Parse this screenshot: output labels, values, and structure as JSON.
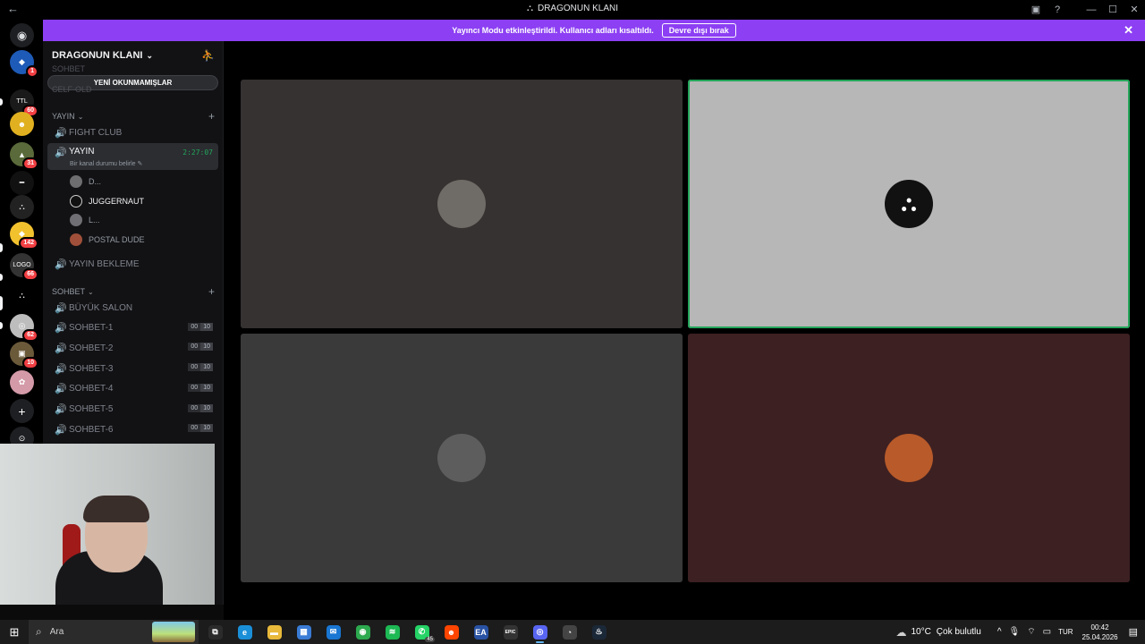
{
  "window": {
    "back_icon": "←",
    "server_logo": "⛬",
    "title": "DRAGONUN KLANI",
    "inbox_icon": "▣",
    "help_icon": "?",
    "minimize_icon": "—",
    "maximize_icon": "☐",
    "close_icon": "✕"
  },
  "banner": {
    "message": "Yayıncı Modu etkinleştirildi. Kullanıcı adları kısaltıldı.",
    "button_label": "Devre dışı bırak",
    "close_icon": "✕"
  },
  "rail": {
    "home_icon": "◉",
    "servers": [
      {
        "label": "◆",
        "badge": "1",
        "color": "#1e5bb8"
      },
      {
        "label": "TTL",
        "badge": "60",
        "color": "#1a1a1a"
      },
      {
        "label": "☻",
        "badge": "",
        "color": "#e0b020"
      },
      {
        "label": "▲",
        "badge": "31",
        "color": "#5a6a3a"
      },
      {
        "label": "━",
        "badge": "",
        "color": "#111"
      },
      {
        "label": "⛬",
        "badge": "",
        "color": "#222"
      },
      {
        "label": "◆",
        "badge": "142",
        "color": "#f2c12e"
      },
      {
        "label": "LOGO",
        "badge": "66",
        "color": "#333"
      },
      {
        "label": "⛬",
        "badge": "",
        "color": "#000"
      },
      {
        "label": "◎",
        "badge": "62",
        "color": "#bdbdbd"
      },
      {
        "label": "▣",
        "badge": "10",
        "color": "#6b5a3a"
      },
      {
        "label": "✿",
        "badge": "",
        "color": "#d49aa8"
      }
    ],
    "add_icon": "+",
    "discover_icon": "⊙"
  },
  "sidebar": {
    "server_name": "DRAGONUN KLANI",
    "chevron": "⌄",
    "invite_icon": "⛹",
    "unread_label": "YENİ OKUNMAMIŞLAR",
    "faded_above": "SOHBET",
    "faded_above_2": "CELF-OLD",
    "categories": {
      "yayin": "YAYIN",
      "sohbet": "SOHBET"
    },
    "cat_chevron": "⌄",
    "plus": "+",
    "channels_yayin": [
      {
        "name": "FIGHT CLUB"
      }
    ],
    "active_channel": {
      "name": "YAYIN",
      "timer": "2:27:07",
      "status": "Bir kanal durumu belirle ✎"
    },
    "members": [
      {
        "name": "D...",
        "bright": false,
        "color": "#6e6e70"
      },
      {
        "name": "JUGGERNAUT",
        "bright": true,
        "color": "#111"
      },
      {
        "name": "L...",
        "bright": false,
        "color": "#707074"
      },
      {
        "name": "POSTAL DUDE",
        "bright": false,
        "color": "#a0503a"
      }
    ],
    "channel_bekleme": "YAYIN BEKLEME",
    "channels_sohbet": [
      {
        "name": "BÜYÜK SALON",
        "limit": false
      },
      {
        "name": "SOHBET-1",
        "limit": true
      },
      {
        "name": "SOHBET-2",
        "limit": true
      },
      {
        "name": "SOHBET-3",
        "limit": true
      },
      {
        "name": "SOHBET-4",
        "limit": true
      },
      {
        "name": "SOHBET-5",
        "limit": true
      },
      {
        "name": "SOHBET-6",
        "limit": true
      }
    ],
    "limit_current": "00",
    "limit_max": "10",
    "speaker_icon": "🔊"
  },
  "main": {
    "tiles": [
      {
        "bg": "#353231",
        "avatar_color": "#6f6b66",
        "speaking": false,
        "label": ""
      },
      {
        "bg": "#b7b7b7",
        "avatar_color": "#111111",
        "speaking": true,
        "label": "⛬"
      },
      {
        "bg": "#3a3a3a",
        "avatar_color": "#5d5d5d",
        "speaking": false,
        "label": ""
      },
      {
        "bg": "#3d2022",
        "avatar_color": "#b85a2a",
        "speaking": false,
        "label": ""
      }
    ]
  },
  "taskbar": {
    "start_icon": "⊞",
    "search_icon": "⌕",
    "search_placeholder": "Ara",
    "apps": [
      {
        "icon": "⧉",
        "color": "#2b2b2b",
        "active": false,
        "badge": ""
      },
      {
        "icon": "e",
        "color": "#1a8fd8",
        "active": false,
        "badge": ""
      },
      {
        "icon": "▬",
        "color": "#e8b93a",
        "active": false,
        "badge": ""
      },
      {
        "icon": "▦",
        "color": "#3a7bd5",
        "active": false,
        "badge": ""
      },
      {
        "icon": "✉",
        "color": "#1976d2",
        "active": false,
        "badge": ""
      },
      {
        "icon": "◉",
        "color": "#2da94f",
        "active": false,
        "badge": ""
      },
      {
        "icon": "≋",
        "color": "#1db954",
        "active": false,
        "badge": ""
      },
      {
        "icon": "✆",
        "color": "#25d366",
        "active": false,
        "badge": "45"
      },
      {
        "icon": "☻",
        "color": "#ff4500",
        "active": false,
        "badge": ""
      },
      {
        "icon": "EA",
        "color": "#2952a3",
        "active": false,
        "badge": ""
      },
      {
        "icon": "EPIC",
        "color": "#333333",
        "active": false,
        "badge": ""
      },
      {
        "icon": "◎",
        "color": "#5865f2",
        "active": true,
        "badge": ""
      },
      {
        "icon": "◔",
        "color": "#444444",
        "active": false,
        "badge": ""
      },
      {
        "icon": "♨",
        "color": "#1b2838",
        "active": false,
        "badge": ""
      }
    ],
    "weather_icon": "☁",
    "weather_temp": "10°C",
    "weather_text": "Çok bulutlu",
    "chevron_up": "^",
    "mic_icon": "🎙",
    "wifi_icon": "⌔",
    "battery_icon": "▭",
    "lang": "TUR",
    "time": "00:42",
    "date": "25.04.2026",
    "notification_icon": "▤"
  }
}
